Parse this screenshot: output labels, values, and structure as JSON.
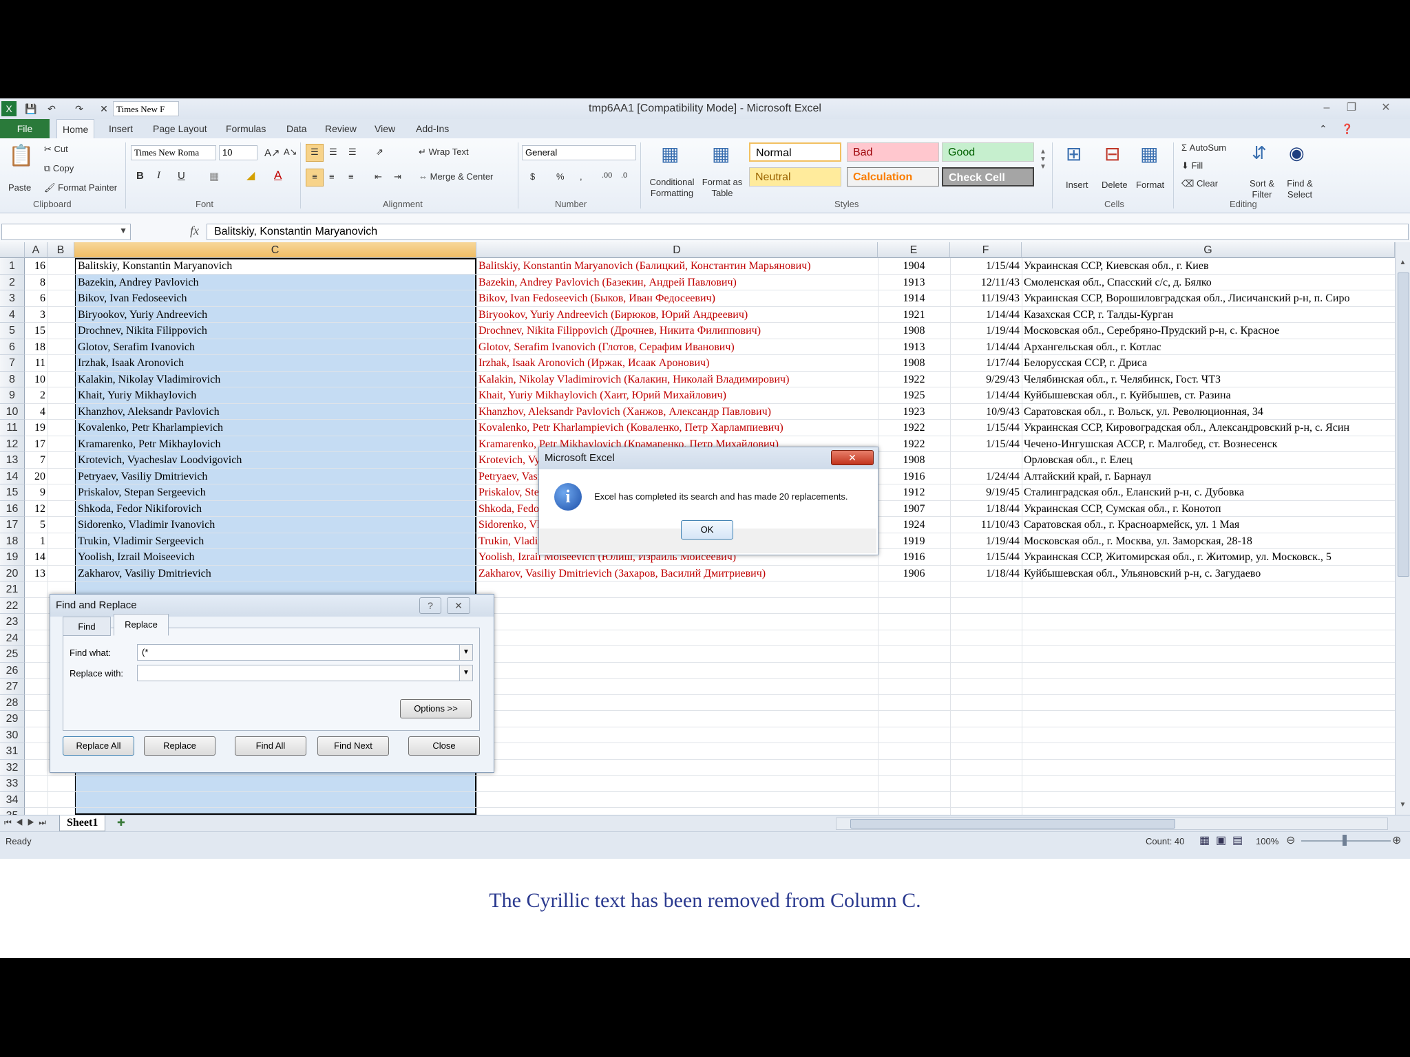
{
  "window": {
    "title": "tmp6AA1  [Compatibility Mode]  -  Microsoft Excel",
    "qat_font": "Times New F"
  },
  "ribbon": {
    "file_tab": "File",
    "tabs": [
      "Home",
      "Insert",
      "Page Layout",
      "Formulas",
      "Data",
      "Review",
      "View",
      "Add-Ins"
    ],
    "clipboard": {
      "paste": "Paste",
      "cut": "Cut",
      "copy": "Copy",
      "format_painter": "Format Painter",
      "label": "Clipboard"
    },
    "font": {
      "name": "Times New Roma",
      "size": "10",
      "label": "Font"
    },
    "alignment": {
      "wrap_text": "Wrap Text",
      "merge_center": "Merge & Center",
      "label": "Alignment"
    },
    "number": {
      "format": "General",
      "label": "Number"
    },
    "styles": {
      "conditional_formatting": "Conditional Formatting",
      "format_as_table": "Format as Table",
      "normal": "Normal",
      "bad": "Bad",
      "good": "Good",
      "neutral": "Neutral",
      "calculation": "Calculation",
      "check_cell": "Check Cell",
      "label": "Styles"
    },
    "cells": {
      "insert": "Insert",
      "delete": "Delete",
      "format": "Format",
      "label": "Cells"
    },
    "editing": {
      "autosum": "AutoSum",
      "fill": "Fill",
      "clear": "Clear",
      "sort_filter": "Sort & Filter",
      "find_select": "Find & Select",
      "label": "Editing"
    }
  },
  "formula_bar": {
    "fx": "fx",
    "content": "Balitskiy, Konstantin Maryanovich"
  },
  "grid": {
    "columns": [
      "A",
      "B",
      "C",
      "D",
      "E",
      "F",
      "G"
    ],
    "row_numbers": [
      "1",
      "2",
      "3",
      "4",
      "5",
      "6",
      "7",
      "8",
      "9",
      "10",
      "11",
      "12",
      "13",
      "14",
      "15",
      "16",
      "17",
      "18",
      "19",
      "20",
      "21",
      "22",
      "23",
      "24",
      "25",
      "26",
      "27",
      "28",
      "29",
      "30",
      "31",
      "32",
      "33",
      "34",
      "35"
    ],
    "rows": [
      {
        "a": "16",
        "c": "Balitskiy, Konstantin Maryanovich",
        "d": "Balitskiy, Konstantin Maryanovich (Балицкий, Константин Марьянович)",
        "e": "1904",
        "f": "1/15/44",
        "g": "Украинская ССР, Киевская обл., г. Киев"
      },
      {
        "a": "8",
        "c": "Bazekin, Andrey Pavlovich",
        "d": "Bazekin, Andrey Pavlovich (Базекин, Андрей Павлович)",
        "e": "1913",
        "f": "12/11/43",
        "g": "Смоленская обл., Спасский с/с, д. Бялко"
      },
      {
        "a": "6",
        "c": "Bikov, Ivan Fedoseevich",
        "d": "Bikov, Ivan Fedoseevich (Быков, Иван Федосеевич)",
        "e": "1914",
        "f": "11/19/43",
        "g": "Украинская ССР, Ворошиловградская обл., Лисичанский р-н, п. Сиро"
      },
      {
        "a": "3",
        "c": "Biryookov, Yuriy Andreevich",
        "d": "Biryookov, Yuriy Andreevich (Бирюков, Юрий Андреевич)",
        "e": "1921",
        "f": "1/14/44",
        "g": "Казахская ССР, г. Талды-Курган"
      },
      {
        "a": "15",
        "c": "Drochnev, Nikita Filippovich",
        "d": "Drochnev, Nikita Filippovich (Дрочнев, Никита Филиппович)",
        "e": "1908",
        "f": "1/19/44",
        "g": "Московская обл., Серебряно-Прудский р-н, с. Красное"
      },
      {
        "a": "18",
        "c": "Glotov, Serafim Ivanovich",
        "d": "Glotov, Serafim Ivanovich (Глотов, Серафим Иванович)",
        "e": "1913",
        "f": "1/14/44",
        "g": "Архангельская обл., г. Котлас"
      },
      {
        "a": "11",
        "c": "Irzhak, Isaak Aronovich",
        "d": "Irzhak, Isaak Aronovich (Иржак, Исаак Аронович)",
        "e": "1908",
        "f": "1/17/44",
        "g": "Белорусская ССР, г. Дриса"
      },
      {
        "a": "10",
        "c": "Kalakin, Nikolay Vladimirovich",
        "d": "Kalakin, Nikolay Vladimirovich (Калакин, Николай Владимирович)",
        "e": "1922",
        "f": "9/29/43",
        "g": "Челябинская обл., г. Челябинск, Гост. ЧТЗ"
      },
      {
        "a": "2",
        "c": "Khait, Yuriy Mikhaylovich",
        "d": "Khait, Yuriy Mikhaylovich (Хаит, Юрий Михайлович)",
        "e": "1925",
        "f": "1/14/44",
        "g": "Куйбышевская обл., г. Куйбышев, ст. Разина"
      },
      {
        "a": "4",
        "c": "Khanzhov, Aleksandr Pavlovich",
        "d": "Khanzhov, Aleksandr Pavlovich (Ханжов, Александр Павлович)",
        "e": "1923",
        "f": "10/9/43",
        "g": "Саратовская обл., г. Вольск, ул. Революционная, 34"
      },
      {
        "a": "19",
        "c": "Kovalenko, Petr Kharlampievich",
        "d": "Kovalenko, Petr Kharlampievich (Коваленко, Петр Харлампиевич)",
        "e": "1922",
        "f": "1/15/44",
        "g": "Украинская ССР, Кировоградская обл., Александровский р-н, с. Ясин"
      },
      {
        "a": "17",
        "c": "Kramarenko, Petr Mikhaylovich",
        "d": "Kramarenko, Petr Mikhaylovich (Крамаренко, Петр Михайлович)",
        "e": "1922",
        "f": "1/15/44",
        "g": "Чечено-Ингушская АССР, г. Малгобед, ст. Вознесенск"
      },
      {
        "a": "7",
        "c": "Krotevich, Vyacheslav Loodvigovich",
        "d": "Krotevich, Vyacheslav Loodvigovich (Кротевич, Вячеслав Людвигович)",
        "e": "1908",
        "f": "",
        "g": "Орловская обл., г. Елец"
      },
      {
        "a": "20",
        "c": "Petryaev, Vasiliy Dmitrievich",
        "d": "Petryaev, Vasiliy Dmitrievich (Петряев, Василий Дмитриевич)",
        "e": "1916",
        "f": "1/24/44",
        "g": "Алтайский край, г. Барнаул"
      },
      {
        "a": "9",
        "c": "Priskalov, Stepan Sergeevich",
        "d": "Priskalov, Stepan Sergeevich (Прискалов, Степан Сергеевич)",
        "e": "1912",
        "f": "9/19/45",
        "g": "Сталинградская обл., Еланский р-н, с. Дубовка"
      },
      {
        "a": "12",
        "c": "Shkoda, Fedor Nikiforovich",
        "d": "Shkoda, Fedor Nikiforovich (Шкода, Федор Никифорович)",
        "e": "1907",
        "f": "1/18/44",
        "g": "Украинская ССР, Сумская обл., г. Конотоп"
      },
      {
        "a": "5",
        "c": "Sidorenko, Vladimir Ivanovich",
        "d": "Sidorenko, Vladimir Ivanovich (Сидоренко, Владимир Иванович)",
        "e": "1924",
        "f": "11/10/43",
        "g": "Саратовская обл., г. Красноармейск, ул. 1 Мая"
      },
      {
        "a": "1",
        "c": "Trukin, Vladimir Sergeevich",
        "d": "Trukin, Vladimir Sergeevich (Трукин, Владимир Сергеевич)",
        "e": "1919",
        "f": "1/19/44",
        "g": "Московская обл., г. Москва, ул. Заморская, 28-18"
      },
      {
        "a": "14",
        "c": "Yoolish, Izrail Moiseevich",
        "d": "Yoolish, Izrail Moiseevich (Юлиш, Израиль Моисеевич)",
        "e": "1916",
        "f": "1/15/44",
        "g": "Украинская ССР, Житомирская обл., г. Житомир, ул. Московск., 5"
      },
      {
        "a": "13",
        "c": "Zakharov, Vasiliy Dmitrievich",
        "d": "Zakharov, Vasiliy Dmitrievich (Захаров, Василий Дмитриевич)",
        "e": "1906",
        "f": "1/18/44",
        "g": "Куйбышевская обл., Ульяновский р-н, с. Загудаево"
      }
    ]
  },
  "sheet_tabs": {
    "active": "Sheet1"
  },
  "status_bar": {
    "ready": "Ready",
    "count": "Count: 40",
    "zoom": "100%"
  },
  "find_replace": {
    "title": "Find and Replace",
    "help": "?",
    "tab_find": "Find",
    "tab_replace": "Replace",
    "find_label": "Find what:",
    "find_value": "(*",
    "replace_label": "Replace with:",
    "replace_value": "",
    "options": "Options >>",
    "replace_all": "Replace All",
    "replace": "Replace",
    "find_all": "Find All",
    "find_next": "Find Next",
    "close": "Close"
  },
  "msgbox": {
    "title": "Microsoft Excel",
    "message": "Excel has completed its search and has made 20 replacements.",
    "ok": "OK"
  },
  "caption": "The Cyrillic text has been removed from Column C.",
  "colors": {
    "accent_green": "#2a7a3a",
    "selection": "#c5dcf3",
    "red_text": "#c00000",
    "caption": "#2b3a8f"
  }
}
